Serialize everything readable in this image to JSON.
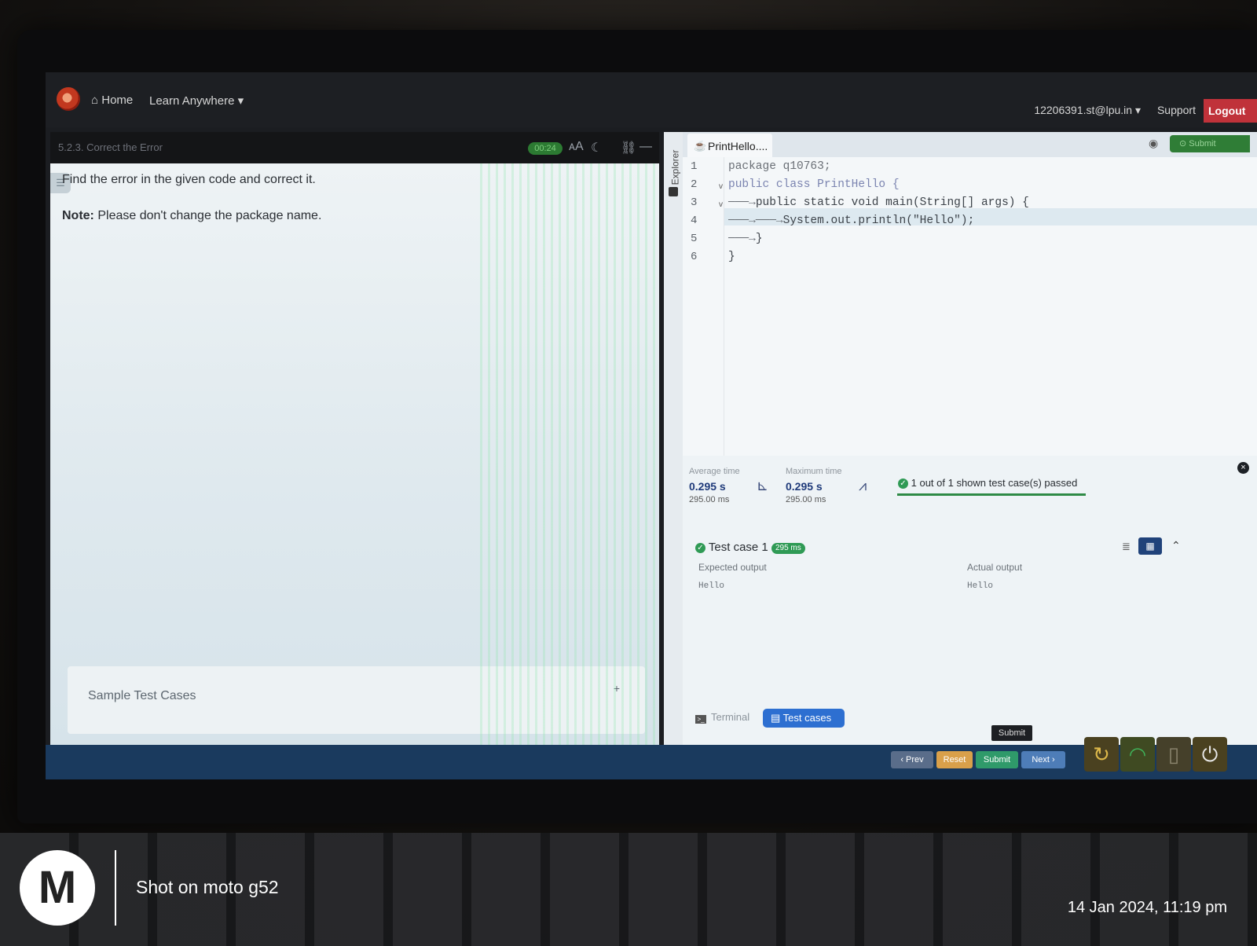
{
  "nav": {
    "home": "Home",
    "learn": "Learn Anywhere",
    "user": "12206391.st@lpu.in",
    "support": "Support",
    "logout": "Logout"
  },
  "question": {
    "title": "5.2.3. Correct the Error",
    "timer": "00:24",
    "text": "Find the error in the given code and correct it.",
    "note_label": "Note:",
    "note_text": "Please don't change the package name.",
    "sample_label": "Sample Test Cases",
    "sample_toggle": "+"
  },
  "editor": {
    "explorer_label": "Explorer",
    "file_tab": "PrintHello....",
    "submit_label": "Submit",
    "line_numbers": [
      "1",
      "2",
      "3",
      "4",
      "5",
      "6"
    ],
    "lines": [
      "package q10763;",
      "public class PrintHello {",
      "public static void main(String[] args) {",
      "System.out.println(\"Hello\");",
      "}",
      "}"
    ]
  },
  "results": {
    "avg_label": "Average time",
    "avg_value": "0.295 s",
    "avg_ms": "295.00 ms",
    "max_label": "Maximum time",
    "max_value": "0.295 s",
    "max_ms": "295.00 ms",
    "passed": "1 out of 1 shown test case(s) passed",
    "testcase_title": "Test case 1",
    "testcase_badge": "295 ms",
    "expected_label": "Expected output",
    "expected_value": "Hello",
    "actual_label": "Actual output",
    "actual_value": "Hello",
    "tab_terminal": "Terminal",
    "tab_testcases": "Test cases"
  },
  "footer": {
    "prev": "‹ Prev",
    "reset": "Reset",
    "submit": "Submit",
    "next": "Next ›",
    "tooltip": "Submit"
  },
  "photo": {
    "brand_text": "Shot on moto g52",
    "timestamp": "14 Jan 2024, 11:19 pm"
  },
  "colors": {
    "logout": "#c0323a",
    "timer": "#2c7a32",
    "pass": "#2f9a55",
    "testcases_tab": "#2d6fd1",
    "bottombar": "#1a3a5e"
  }
}
